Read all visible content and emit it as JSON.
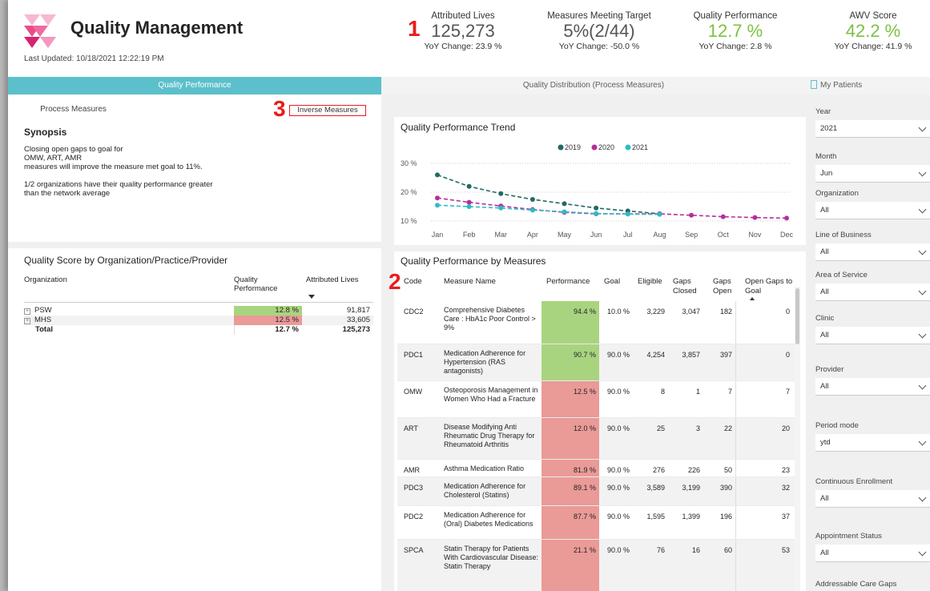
{
  "header": {
    "title": "Quality Management",
    "last_updated": "Last Updated: 10/18/2021 12:22:19 PM",
    "markers": [
      "1",
      "2",
      "3"
    ]
  },
  "kpis": [
    {
      "label": "Attributed Lives",
      "value": "125,273",
      "yoy": "YoY Change: 23.9 %"
    },
    {
      "label": "Measures Meeting Target",
      "value": "5%(2/44)",
      "yoy": "YoY Change: -50.0 %"
    },
    {
      "label": "Quality Performance",
      "value": "12.7 %",
      "yoy": "YoY Change: 2.8 %"
    },
    {
      "label": "AWV Score",
      "value": "42.2 %",
      "yoy": "YoY Change: 41.9 %"
    }
  ],
  "tabs": [
    "Quality Performance",
    "Quality Distribution (Process Measures)",
    "My Patients"
  ],
  "subtabs": [
    "Process Measures",
    "Inverse Measures"
  ],
  "synopsis": {
    "title": "Synopsis",
    "lines": [
      "Closing open gaps to goal for",
      "OMW, ART, AMR",
      "measures will improve the measure met goal to 11%.",
      "",
      "1/2 organizations have their quality performance greater",
      "than the network average"
    ]
  },
  "org_table": {
    "title": "Quality Score by Organization/Practice/Provider",
    "headers": [
      "Organization",
      "Quality Performance",
      "Attributed Lives"
    ],
    "rows": [
      {
        "org": "PSW",
        "perf": "12.8 %",
        "lives": "91,817"
      },
      {
        "org": "MHS",
        "perf": "12.5 %",
        "lives": "33,605"
      }
    ],
    "total": {
      "org": "Total",
      "perf": "12.7 %",
      "lives": "125,273"
    }
  },
  "chart_data": {
    "type": "line",
    "title": "Quality Performance Trend",
    "categories": [
      "Jan",
      "Feb",
      "Mar",
      "Apr",
      "May",
      "Jun",
      "Jul",
      "Aug",
      "Sep",
      "Oct",
      "Nov",
      "Dec"
    ],
    "series": [
      {
        "name": "2019",
        "color": "#1f6b63",
        "values": [
          26,
          22,
          19.5,
          17.5,
          16,
          14.5,
          13.5,
          12.5,
          null,
          null,
          null,
          null
        ]
      },
      {
        "name": "2020",
        "color": "#b42f9d",
        "values": [
          18,
          16.5,
          15.2,
          14,
          13,
          12.5,
          12.5,
          12.5,
          12,
          11.5,
          11.2,
          11
        ]
      },
      {
        "name": "2021",
        "color": "#2fbbc3",
        "values": [
          15.5,
          15,
          14.5,
          13.8,
          13.2,
          12.6,
          12.4,
          12.3,
          null,
          null,
          null,
          null
        ]
      }
    ],
    "yticks": [
      "30 %",
      "20 %",
      "10 %"
    ],
    "ylim": [
      10,
      30
    ],
    "grid": true,
    "legend": "top"
  },
  "measures_table": {
    "title": "Quality Performance by Measures",
    "headers": [
      "Code",
      "Measure Name",
      "Performance",
      "Goal",
      "Eligible",
      "Gaps Closed",
      "Gaps Open",
      "Open Gaps to Goal"
    ],
    "rows": [
      {
        "code": "CDC2",
        "name": "Comprehensive Diabetes Care : HbA1c Poor Control > 9%",
        "perf": "94.4 %",
        "goal": "10.0 %",
        "eligible": "3,229",
        "closed": "3,047",
        "open": "182",
        "to_goal": "0",
        "status": "good"
      },
      {
        "code": "PDC1",
        "name": "Medication Adherence for Hypertension (RAS antagonists)",
        "perf": "90.7 %",
        "goal": "90.0 %",
        "eligible": "4,254",
        "closed": "3,857",
        "open": "397",
        "to_goal": "0",
        "status": "good"
      },
      {
        "code": "OMW",
        "name": "Osteoporosis Management in Women Who Had a Fracture",
        "perf": "12.5 %",
        "goal": "90.0 %",
        "eligible": "8",
        "closed": "1",
        "open": "7",
        "to_goal": "7",
        "status": "bad"
      },
      {
        "code": "ART",
        "name": "Disease Modifying Anti Rheumatic Drug Therapy for Rheumatoid Arthritis",
        "perf": "12.0 %",
        "goal": "90.0 %",
        "eligible": "25",
        "closed": "3",
        "open": "22",
        "to_goal": "20",
        "status": "bad"
      },
      {
        "code": "AMR",
        "name": "Asthma Medication Ratio",
        "perf": "81.9 %",
        "goal": "90.0 %",
        "eligible": "276",
        "closed": "226",
        "open": "50",
        "to_goal": "23",
        "status": "bad"
      },
      {
        "code": "PDC3",
        "name": "Medication Adherence for Cholesterol (Statins)",
        "perf": "89.1 %",
        "goal": "90.0 %",
        "eligible": "3,589",
        "closed": "3,199",
        "open": "390",
        "to_goal": "32",
        "status": "bad"
      },
      {
        "code": "PDC2",
        "name": "Medication Adherence for (Oral) Diabetes Medications",
        "perf": "87.7 %",
        "goal": "90.0 %",
        "eligible": "1,595",
        "closed": "1,399",
        "open": "196",
        "to_goal": "37",
        "status": "bad"
      },
      {
        "code": "SPCA",
        "name": "Statin Therapy for Patients With Cardiovascular Disease: Statin Therapy",
        "perf": "21.1 %",
        "goal": "90.0 %",
        "eligible": "76",
        "closed": "16",
        "open": "60",
        "to_goal": "53",
        "status": "bad"
      }
    ]
  },
  "slicers": [
    {
      "label": "Year",
      "value": "2021"
    },
    {
      "label": "Month",
      "value": "Jun"
    },
    {
      "label": "Organization",
      "value": "All"
    },
    {
      "label": "Line of Business",
      "value": "All"
    },
    {
      "label": "Area of Service",
      "value": "All"
    },
    {
      "label": "Clinic",
      "value": "All"
    },
    {
      "label": "Provider",
      "value": "All"
    },
    {
      "label": "Period mode",
      "value": "ytd"
    },
    {
      "label": "Continuous Enrollment",
      "value": "All"
    },
    {
      "label": "Appointment Status",
      "value": "All"
    },
    {
      "label": "Addressable Care Gaps",
      "value": ""
    }
  ],
  "colors": {
    "accent": "#5bc0cb",
    "good": "#a9d47f",
    "bad": "#ea9a97",
    "kpi_green": "#7bc143",
    "marker": "#e81c1c"
  }
}
